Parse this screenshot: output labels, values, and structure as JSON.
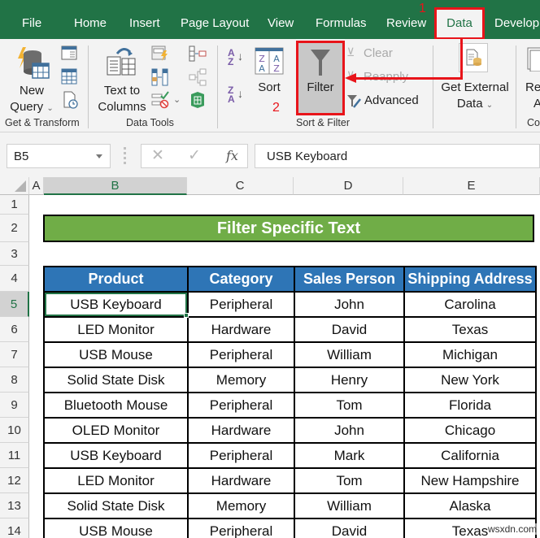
{
  "ribbon_tabs": [
    {
      "label": "File"
    },
    {
      "label": "Home"
    },
    {
      "label": "Insert"
    },
    {
      "label": "Page Layout"
    },
    {
      "label": "View"
    },
    {
      "label": "Formulas"
    },
    {
      "label": "Review"
    },
    {
      "label": "Data",
      "active": true
    },
    {
      "label": "Develop"
    }
  ],
  "ribbon": {
    "get_transform": {
      "new_query_line1": "New",
      "new_query_line2": "Query",
      "group_label": "Get & Transform"
    },
    "data_tools": {
      "text_to_columns_line1": "Text to",
      "text_to_columns_line2": "Columns",
      "group_label": "Data Tools"
    },
    "sort_filter": {
      "sort_label": "Sort",
      "filter_label": "Filter",
      "clear_label": "Clear",
      "reapply_label": "Reapply",
      "advanced_label": "Advanced",
      "group_label": "Sort & Filter"
    },
    "get_external": {
      "line1": "Get External",
      "line2": "Data"
    },
    "connections": {
      "refresh_line1": "Re",
      "refresh_line2": "A",
      "group_label": "Co"
    }
  },
  "annotations": {
    "step1": "1",
    "step2": "2",
    "color": "#e8141a"
  },
  "formula_bar": {
    "name_box": "B5",
    "cancel_icon": "✕",
    "enter_icon": "✓",
    "fx_label": "fx",
    "content": "USB Keyboard"
  },
  "grid": {
    "columns": [
      "A",
      "B",
      "C",
      "D",
      "E"
    ],
    "selected_column": "B",
    "rows": [
      "1",
      "2",
      "3",
      "4",
      "5",
      "6",
      "7",
      "8",
      "9",
      "10",
      "11",
      "12",
      "13",
      "14"
    ],
    "selected_row": "5"
  },
  "sheet": {
    "title": "Filter Specific Text",
    "title_color": "#70ad47",
    "header_color": "#2e75b6",
    "headers": [
      "Product",
      "Category",
      "Sales Person",
      "Shipping Address"
    ],
    "rows": [
      [
        "USB Keyboard",
        "Peripheral",
        "John",
        "Carolina"
      ],
      [
        "LED Monitor",
        "Hardware",
        "David",
        "Texas"
      ],
      [
        "USB Mouse",
        "Peripheral",
        "William",
        "Michigan"
      ],
      [
        "Solid State Disk",
        "Memory",
        "Henry",
        "New York"
      ],
      [
        "Bluetooth Mouse",
        "Peripheral",
        "Tom",
        "Florida"
      ],
      [
        "OLED Monitor",
        "Hardware",
        "John",
        "Chicago"
      ],
      [
        "USB Keyboard",
        "Peripheral",
        "Mark",
        "California"
      ],
      [
        "LED Monitor",
        "Hardware",
        "Tom",
        "New Hampshire"
      ],
      [
        "Solid State Disk",
        "Memory",
        "William",
        "Alaska"
      ],
      [
        "USB Mouse",
        "Peripheral",
        "David",
        "Texas"
      ]
    ]
  },
  "watermark": "wsxdn.com"
}
